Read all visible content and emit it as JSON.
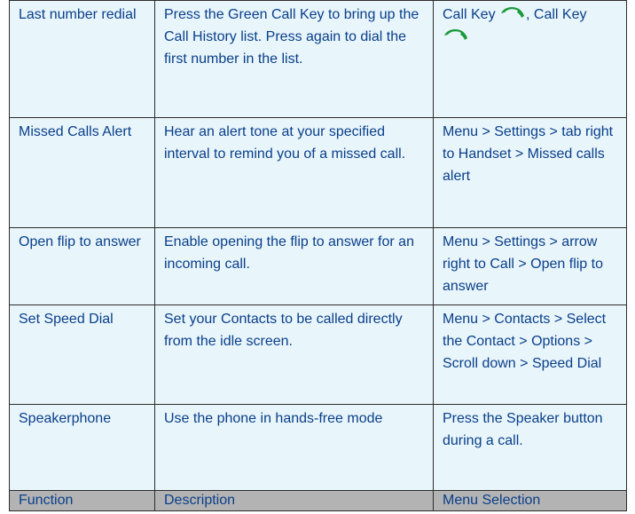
{
  "rows": [
    {
      "function": "Last number redial",
      "description": "Press the Green Call Key to bring up the Call History list. Press again to dial the first number in the list.",
      "menu_parts": [
        "Call Key",
        ", Call Key"
      ],
      "menu_icon": "green-call-key-icon",
      "icon_color": "#1a9a3a"
    },
    {
      "function": "Missed Calls Alert",
      "description": "Hear an alert tone at your specified interval to remind you of a missed call.",
      "menu": "Menu > Settings > tab right to Handset > Missed calls alert"
    },
    {
      "function": "Open flip to answer",
      "description": "Enable opening the flip to answer for an incoming call.",
      "menu": "Menu > Settings > arrow right to Call > Open flip to answer"
    },
    {
      "function": "Set Speed Dial",
      "description": "Set your Contacts to be called directly from the idle screen.",
      "menu": "Menu > Contacts > Select the Contact > Options > Scroll down > Speed Dial"
    },
    {
      "function": "Speakerphone",
      "description": "Use the phone in hands-free mode",
      "menu": "Press the Speaker button during a call."
    }
  ],
  "header": {
    "function": "Function",
    "description": "Description",
    "menu": "Menu Selection"
  },
  "colors": {
    "text": "#0a3f8a",
    "cell_background": "#e8f5fb",
    "header_background": "#b3b3b3",
    "border": "#2c2c2c"
  }
}
